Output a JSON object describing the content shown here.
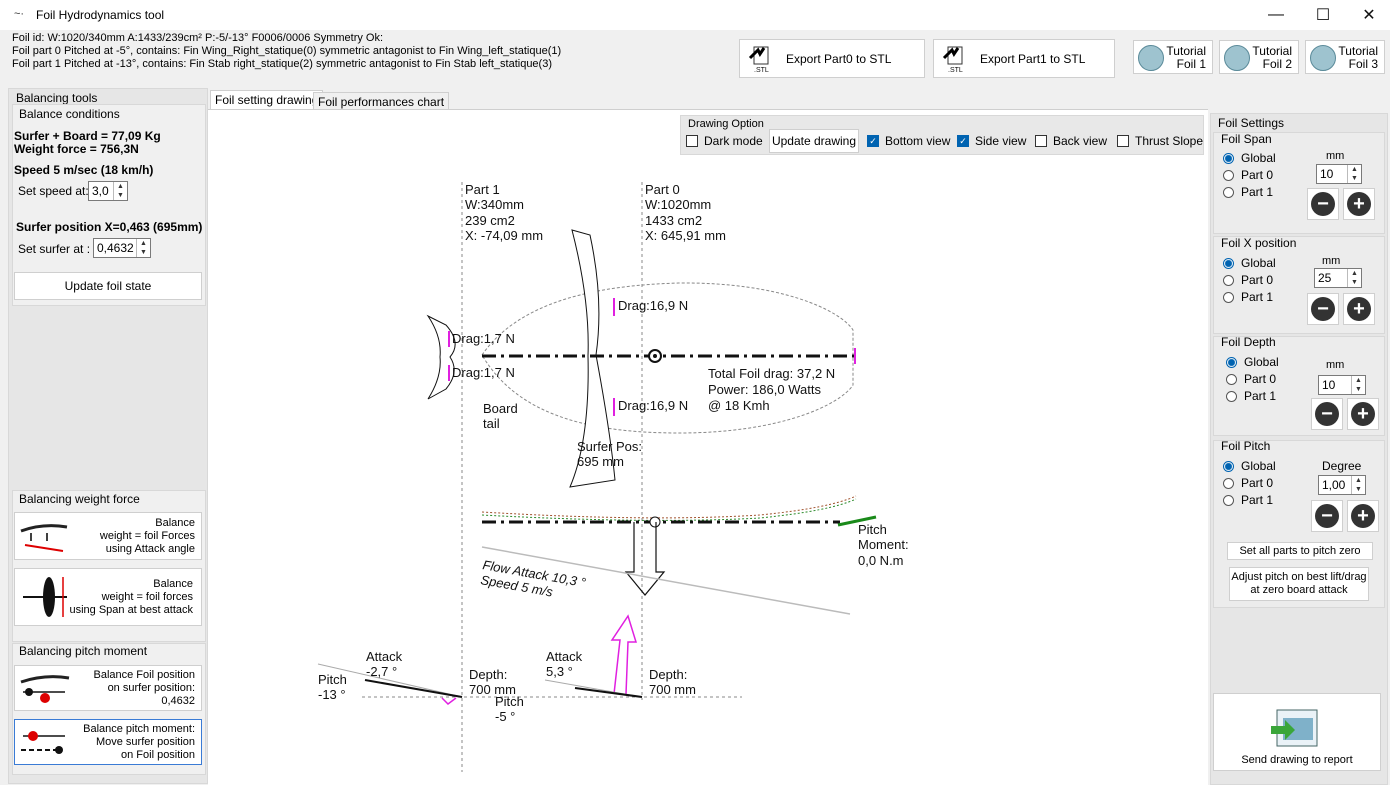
{
  "window": {
    "title": "Foil Hydrodynamics tool",
    "icon": "app-icon",
    "controls": {
      "minimize": "—",
      "maximize": "☐",
      "close": "✕"
    }
  },
  "info": {
    "line1": "Foil id:  W:1020/340mm A:1433/239cm² P:-5/-13° F0006/0006 Symmetry Ok:",
    "line2": "Foil part 0 Pitched at  -5°, contains: Fin Wing_Right_statique(0) symmetric antagonist to Fin Wing_left_statique(1)",
    "line3": "Foil part 1 Pitched at  -13°, contains: Fin Stab right_statique(2) symmetric antagonist to Fin Stab left_statique(3)"
  },
  "toolbar": {
    "export0": "Export Part0 to STL",
    "export1": "Export Part1 to STL",
    "stl_icon_text": ".STL",
    "tutorials": [
      {
        "line1": "Tutorial",
        "line2": "Foil 1"
      },
      {
        "line1": "Tutorial",
        "line2": "Foil 2"
      },
      {
        "line1": "Tutorial",
        "line2": "Foil 3"
      }
    ]
  },
  "left": {
    "balancing_tools": "Balancing tools",
    "balance_conditions": "Balance conditions",
    "surfer_board": "Surfer + Board = 77,09 Kg",
    "weight_force": "Weight force = 756,3N",
    "speed": "Speed 5 m/sec (18 km/h)",
    "set_speed_label": "Set speed at:",
    "set_speed_value": "3,0",
    "surfer_position": "Surfer position X=0,463 (695mm)",
    "set_surfer_label": "Set surfer at :",
    "set_surfer_value": "0,4632",
    "update_button": "Update foil state",
    "balancing_weight_force": "Balancing weight force",
    "bw_btn1": {
      "l1": "Balance",
      "l2": "weight = foil Forces",
      "l3": "using Attack angle"
    },
    "bw_btn2": {
      "l1": "Balance",
      "l2": "weight = foil forces",
      "l3": "using Span at best attack"
    },
    "balancing_pitch_moment": "Balancing pitch moment",
    "bp_btn1": {
      "l1": "Balance Foil position",
      "l2": "on surfer position:",
      "l3": "0,4632"
    },
    "bp_btn2": {
      "l1": "Balance pitch moment:",
      "l2": "Move surfer position",
      "l3": "on Foil position"
    }
  },
  "tabs": [
    {
      "label": "Foil setting drawing",
      "active": true
    },
    {
      "label": "Foil performances chart",
      "active": false
    }
  ],
  "drawing_option": {
    "title": "Drawing Option",
    "dark_mode": "Dark mode",
    "update_drawing": "Update drawing",
    "bottom_view": "Bottom view",
    "side_view": "Side view",
    "back_view": "Back view",
    "thrust_slope": "Thrust Slope",
    "checks": {
      "dark_mode": false,
      "bottom_view": true,
      "side_view": true,
      "back_view": false,
      "thrust_slope": false
    }
  },
  "drawing": {
    "part1": [
      "Part 1",
      "W:340mm",
      "239 cm2",
      "X: -74,09 mm"
    ],
    "part0": [
      "Part 0",
      "W:1020mm",
      "1433 cm2",
      "X: 645,91 mm"
    ],
    "drag_wing": "Drag:16,9 N",
    "drag_stab": "Drag:1,7 N",
    "total": [
      "Total Foil drag: 37,2 N",
      "Power: 186,0 Watts",
      "@ 18 Kmh"
    ],
    "board_tail": [
      "Board",
      "tail"
    ],
    "surfer_pos": [
      "Surfer Pos:",
      "695 mm"
    ],
    "pitch_moment": [
      "Pitch",
      "Moment:",
      "0,0 N.m"
    ],
    "flow": [
      "Flow Attack 10,3 °",
      "Speed 5 m/s"
    ],
    "attack_stab": [
      "Attack",
      "-2,7 °"
    ],
    "attack_wing": [
      "Attack",
      "5,3 °"
    ],
    "pitch_stab": [
      "Pitch",
      "-13 °"
    ],
    "pitch_wing": [
      "Pitch",
      "-5 °"
    ],
    "depth_stab": [
      "Depth:",
      "700 mm"
    ],
    "depth_wing": [
      "Depth:",
      "700 mm"
    ],
    "colors": {
      "drag": "#e020e0",
      "pitch_line": "#1a8a1a",
      "dash": "#888888"
    }
  },
  "right": {
    "foil_settings": "Foil Settings",
    "radio_global": "Global",
    "radio_part0": "Part 0",
    "radio_part1": "Part 1",
    "span": {
      "title": "Foil Span",
      "unit": "mm",
      "value": "10"
    },
    "xpos": {
      "title": "Foil X position",
      "unit": "mm",
      "value": "25"
    },
    "depth": {
      "title": "Foil Depth",
      "unit": "mm",
      "value": "10"
    },
    "pitch": {
      "title": "Foil Pitch",
      "unit": "Degree",
      "value": "1,00"
    },
    "minus": "−",
    "plus": "+",
    "set_pitch_zero": "Set all parts to pitch zero",
    "adjust_pitch": [
      "Adjust pitch on best lift/drag",
      "at zero board attack"
    ],
    "send_report": "Send drawing to report"
  }
}
